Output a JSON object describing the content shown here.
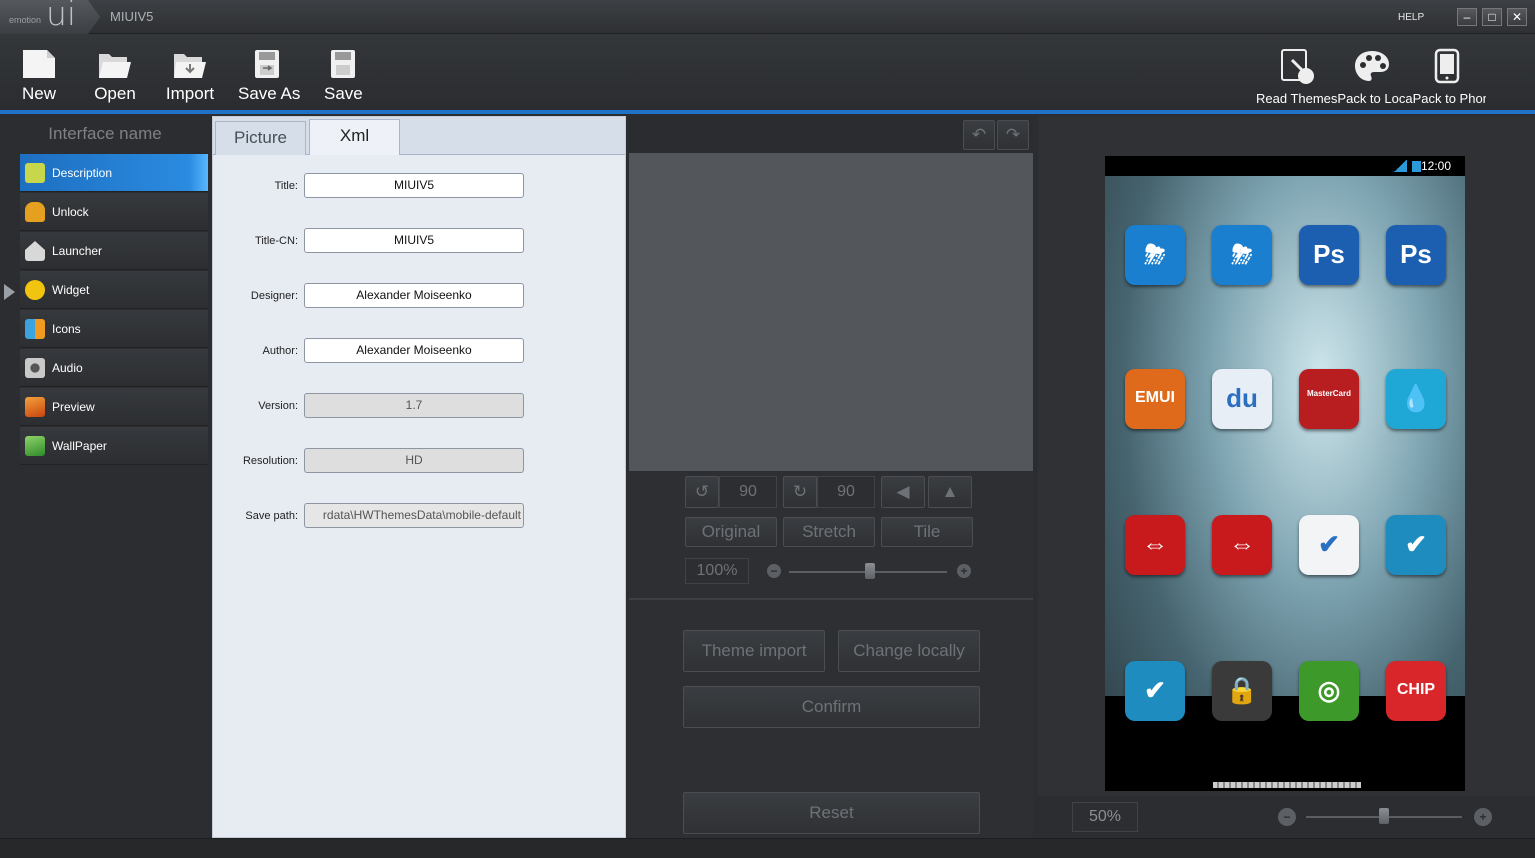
{
  "app": {
    "logo_small": "emotion",
    "logo_big": "ui",
    "title": "MIUIV5",
    "help": "HELP"
  },
  "window_controls": {
    "minimize": "–",
    "maximize": "□",
    "close": "✕"
  },
  "toolbar": {
    "new": "New",
    "open": "Open",
    "import": "Import",
    "save_as": "Save As",
    "save": "Save"
  },
  "right_toolbar": {
    "labels": "Read ThemesPack to LocaPack to Phone",
    "icons": [
      "read-themes-icon",
      "palette-icon",
      "phone-icon"
    ]
  },
  "sidebar": {
    "header": "Interface name",
    "items": [
      {
        "label": "Description",
        "icon": "notepad-icon",
        "color": "#c7d64a"
      },
      {
        "label": "Unlock",
        "icon": "lock-icon",
        "color": "#e5a020"
      },
      {
        "label": "Launcher",
        "icon": "home-icon",
        "color": "#d8d8d8"
      },
      {
        "label": "Widget",
        "icon": "sun-icon",
        "color": "#f1c40f"
      },
      {
        "label": "Icons",
        "icon": "icons-grid-icon",
        "color": "#3aa3e0"
      },
      {
        "label": "Audio",
        "icon": "speaker-icon",
        "color": "#c9c9c9"
      },
      {
        "label": "Preview",
        "icon": "picture-icon",
        "color": "#e36b1a"
      },
      {
        "label": "WallPaper",
        "icon": "wallpaper-icon",
        "color": "#58b947"
      }
    ]
  },
  "tabs": {
    "picture": "Picture",
    "xml": "Xml"
  },
  "form": {
    "title_label": "Title:",
    "title_value": "MIUIV5",
    "title_cn_label": "Title-CN:",
    "title_cn_value": "MIUIV5",
    "designer_label": "Designer:",
    "designer_value": "Alexander Moiseenko",
    "author_label": "Author:",
    "author_value": "Alexander Moiseenko",
    "version_label": "Version:",
    "version_value": "1.7",
    "resolution_label": "Resolution:",
    "resolution_value": "HD",
    "save_path_label": "Save path:",
    "save_path_value": "rdata\\HWThemesData\\mobile-default"
  },
  "editor": {
    "rotate_left_value": "90",
    "rotate_right_value": "90",
    "original": "Original",
    "stretch": "Stretch",
    "tile": "Tile",
    "zoom": "100%",
    "zoom_level": 0.5,
    "theme_import": "Theme import",
    "change_locally": "Change locally",
    "confirm": "Confirm",
    "reset": "Reset",
    "undo": "↶",
    "redo": "↷"
  },
  "phone": {
    "clock": "12:00",
    "zoom": "50%",
    "zoom_level": 0.5,
    "apps": [
      {
        "name": "weather-icon",
        "text": "⛈",
        "color": "#1a7fcf"
      },
      {
        "name": "weather-icon-2",
        "text": "⛈",
        "color": "#1a7fcf"
      },
      {
        "name": "photoshop-icon",
        "text": "Ps",
        "color": "#1c5fb0"
      },
      {
        "name": "photoshop-icon-2",
        "text": "Ps",
        "color": "#1c5fb0"
      },
      {
        "name": "emui-icon",
        "text": "EMUI",
        "color": "#e06a1c"
      },
      {
        "name": "baidu-icon",
        "text": "du",
        "color": "#e8eef5"
      },
      {
        "name": "mastercard-icon",
        "text": "MasterCard",
        "color": "#b81d20"
      },
      {
        "name": "drupal-icon",
        "text": "💧",
        "color": "#1fa7d6"
      },
      {
        "name": "sbb-icon",
        "text": "⇔",
        "color": "#c8191d"
      },
      {
        "name": "sbb-icon-2",
        "text": "⇔",
        "color": "#c8191d"
      },
      {
        "name": "notes-check-icon",
        "text": "✔",
        "color": "#f2f4f6"
      },
      {
        "name": "check-icon",
        "text": "✔",
        "color": "#1f8cc0"
      },
      {
        "name": "check-icon-2",
        "text": "✔",
        "color": "#1f8cc0"
      },
      {
        "name": "secure-chat-icon",
        "text": "🔒",
        "color": "#3a3a3a"
      },
      {
        "name": "green-swirl-icon",
        "text": "◎",
        "color": "#3d9a2a"
      },
      {
        "name": "chip-icon",
        "text": "CHIP",
        "color": "#d8262a"
      }
    ]
  }
}
